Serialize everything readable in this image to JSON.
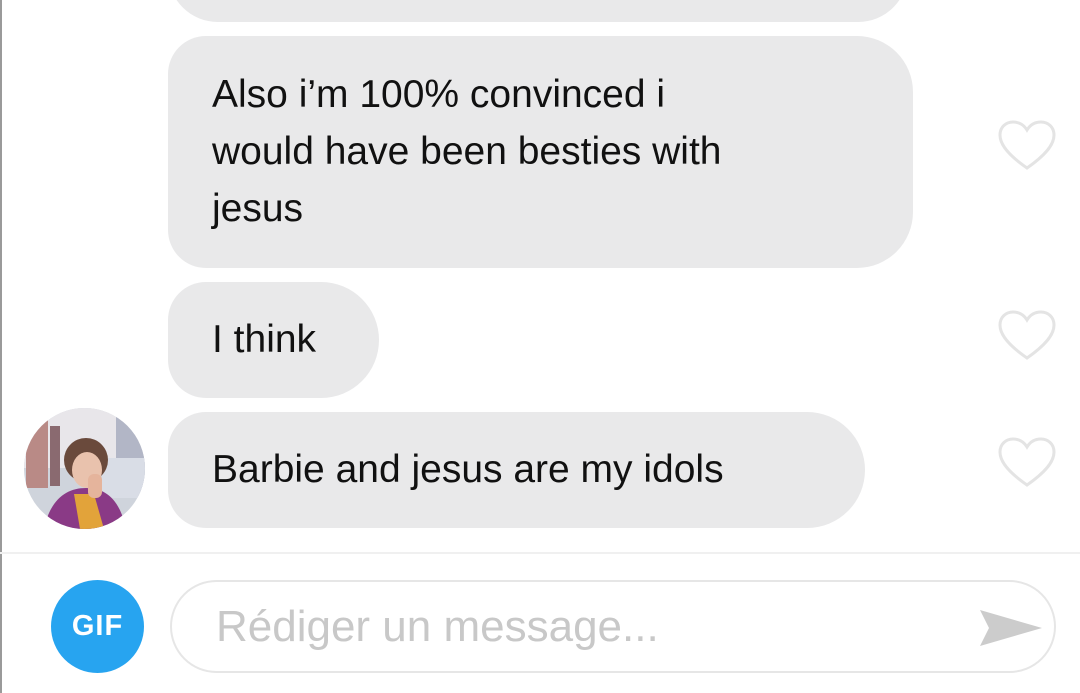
{
  "messages": [
    {
      "text": ""
    },
    {
      "text": "Also i’m 100% convinced i\nwould have been besties with\njesus",
      "liked": false
    },
    {
      "text": "I think",
      "liked": false
    },
    {
      "text": "Barbie and jesus are my idols",
      "liked": false
    }
  ],
  "icons": {
    "like": "heart-outline-icon",
    "send": "send-arrow-icon"
  },
  "composer": {
    "gif_label": "GIF",
    "placeholder": "Rédiger un message...",
    "value": ""
  },
  "colors": {
    "bubble": "#e9e9ea",
    "gif_button": "#27a4f0",
    "placeholder": "#c8c8c8"
  }
}
